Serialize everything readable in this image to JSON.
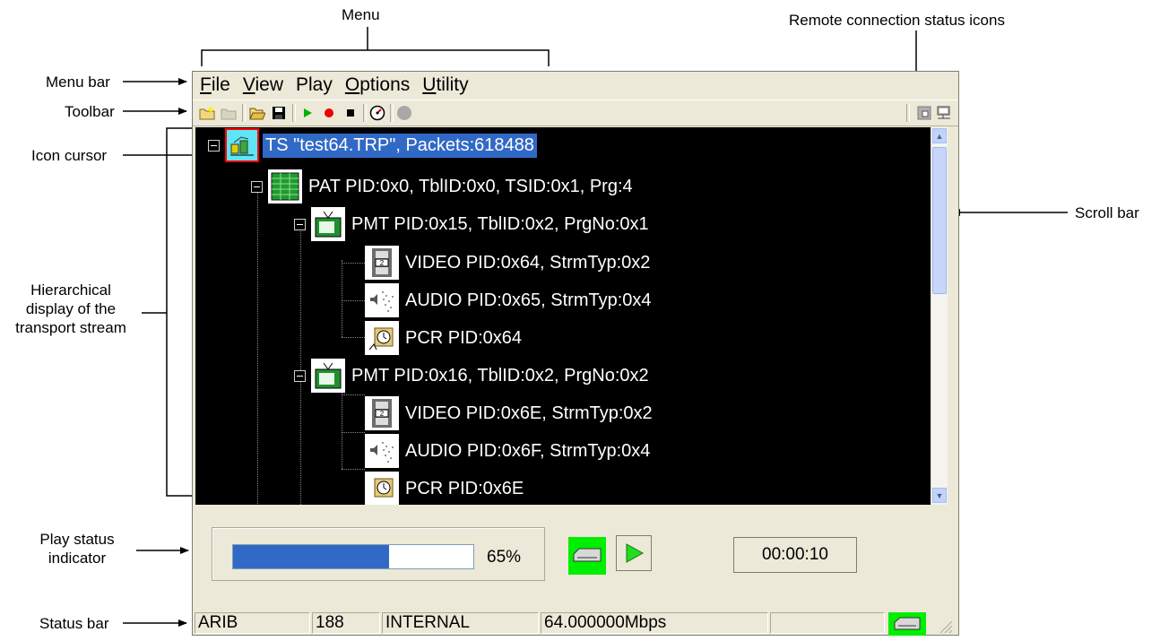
{
  "callouts": {
    "menu": "Menu",
    "remote_status": "Remote connection status icons",
    "menu_bar": "Menu bar",
    "toolbar": "Toolbar",
    "icon_cursor": "Icon cursor",
    "scroll_bar": "Scroll bar",
    "hierarchical_line1": "Hierarchical",
    "hierarchical_line2": "display of the",
    "hierarchical_line3": "transport stream",
    "play_status_line1": "Play status",
    "play_status_line2": "indicator",
    "status_bar": "Status bar"
  },
  "menubar": {
    "items": [
      {
        "accel": "F",
        "rest": "ile"
      },
      {
        "accel": "V",
        "rest": "iew"
      },
      {
        "accel": "P",
        "rest": "lay"
      },
      {
        "accel": "O",
        "rest": "ptions"
      },
      {
        "accel": "U",
        "rest": "tility"
      }
    ]
  },
  "toolbar": {
    "buttons": [
      "new-folder-icon",
      "folder-icon",
      "open-folder-icon",
      "save-icon",
      "play-icon",
      "record-icon",
      "stop-icon",
      "speedometer-icon",
      "circle-disabled-icon"
    ],
    "remote_icons": [
      "remote-connect-icon",
      "network-computer-icon"
    ]
  },
  "tree": {
    "nodes": [
      {
        "label": "TS \"test64.TRP\", Packets:618488",
        "icon": "transport-stream-icon",
        "selected": true
      },
      {
        "label": "PAT PID:0x0, TblID:0x0, TSID:0x1, Prg:4",
        "icon": "pat-table-icon"
      },
      {
        "label": "PMT PID:0x15, TblID:0x2, PrgNo:0x1",
        "icon": "tv-icon"
      },
      {
        "label": "VIDEO PID:0x64, StrmTyp:0x2",
        "icon": "video-film-icon"
      },
      {
        "label": "AUDIO PID:0x65, StrmTyp:0x4",
        "icon": "audio-speaker-icon"
      },
      {
        "label": "PCR PID:0x64",
        "icon": "pcr-clock-icon"
      },
      {
        "label": "PMT PID:0x16, TblID:0x2, PrgNo:0x2",
        "icon": "tv-icon"
      },
      {
        "label": "VIDEO PID:0x6E, StrmTyp:0x2",
        "icon": "video-film-icon"
      },
      {
        "label": "AUDIO PID:0x6F, StrmTyp:0x4",
        "icon": "audio-speaker-icon"
      },
      {
        "label": "PCR PID:0x6E",
        "icon": "pcr-clock-icon"
      }
    ]
  },
  "play_status": {
    "progress_fraction": 0.65,
    "progress_text": "65%",
    "elapsed": "00:00:10"
  },
  "statusbar": {
    "standard": "ARIB",
    "packet_size": "188",
    "clock": "INTERNAL",
    "rate": "64.000000Mbps",
    "empty": ""
  },
  "colors": {
    "window_bg": "#ece9d8",
    "tree_bg": "#000000",
    "selection": "#3169c6",
    "progress": "#3169c6",
    "indicator_green": "#00ee00",
    "cursor_red": "#ff0000"
  }
}
